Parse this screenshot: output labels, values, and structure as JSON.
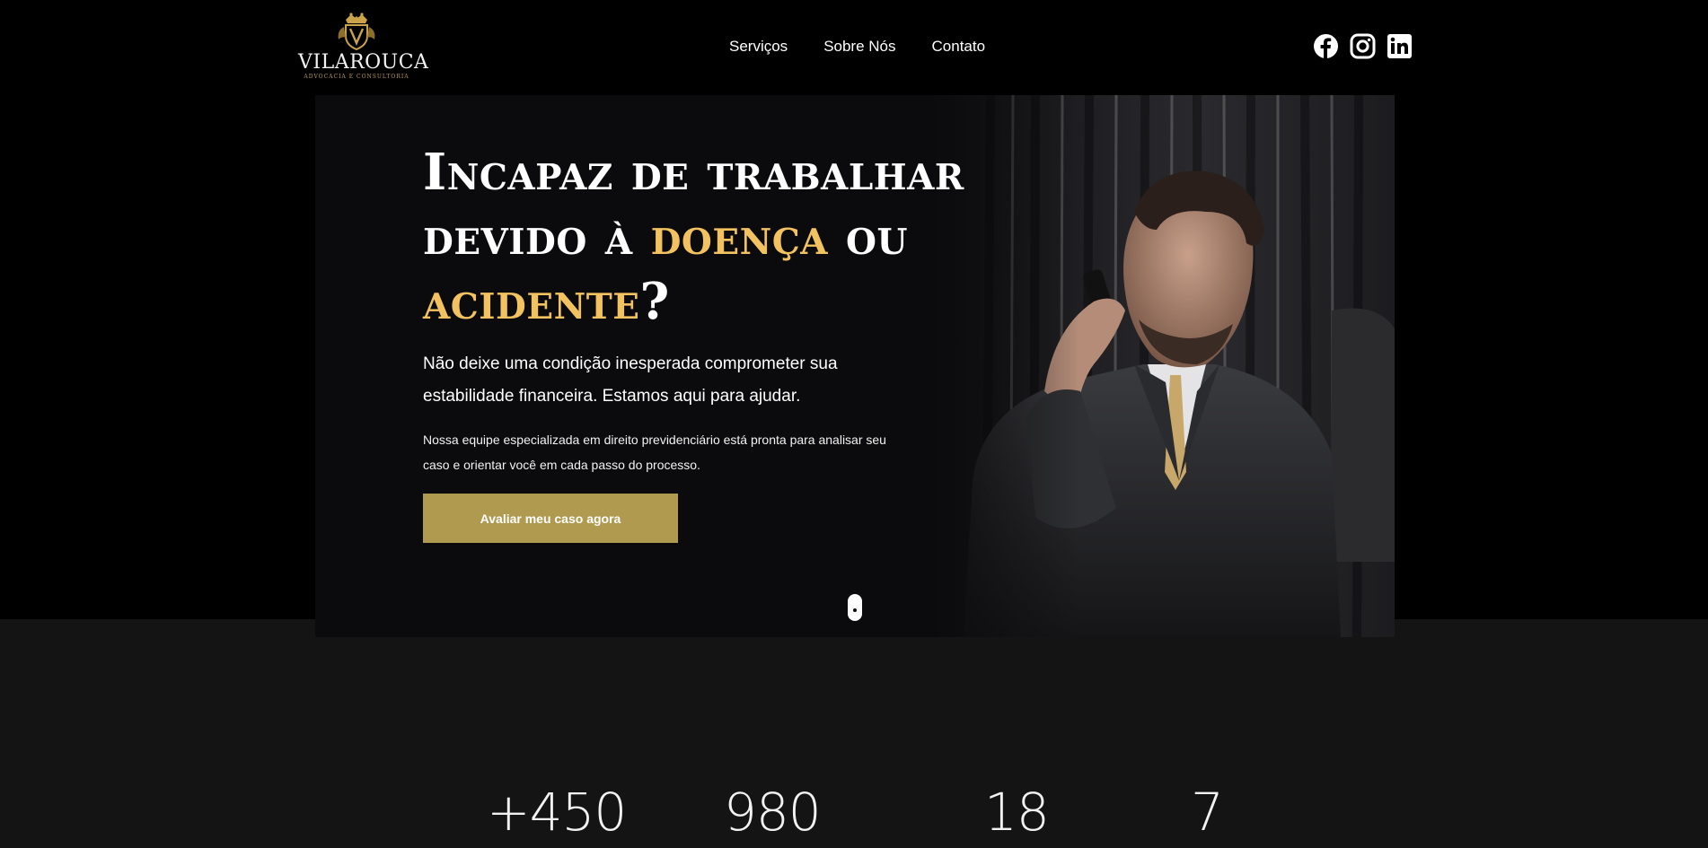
{
  "brand": {
    "name": "VILAROUCA",
    "tagline": "ADVOCACIA E CONSULTORIA",
    "gold": "#c9a24a"
  },
  "nav": {
    "items": [
      {
        "label": "Serviços"
      },
      {
        "label": "Sobre Nós"
      },
      {
        "label": "Contato"
      }
    ]
  },
  "socials": [
    {
      "icon": "facebook-icon"
    },
    {
      "icon": "instagram-icon"
    },
    {
      "icon": "linkedin-icon"
    }
  ],
  "hero": {
    "title_part1": "Incapaz de trabalhar devido à ",
    "title_highlight1": "doença",
    "title_part2": " ou ",
    "title_highlight2": "acidente",
    "title_part3": "?",
    "lead": "Não deixe uma condição inesperada comprometer sua estabilidade financeira. Estamos aqui para ajudar.",
    "text": "Nossa equipe especializada em direito previdenciário está pronta para analisar seu caso e orientar você em cada passo do processo.",
    "cta_label": "Avaliar meu caso agora",
    "highlight_color": "#f2c260",
    "button_color": "#b09a4f"
  },
  "stats": {
    "items": [
      {
        "value": "+450"
      },
      {
        "value": "980"
      },
      {
        "value": "18"
      },
      {
        "value": "7"
      }
    ]
  }
}
